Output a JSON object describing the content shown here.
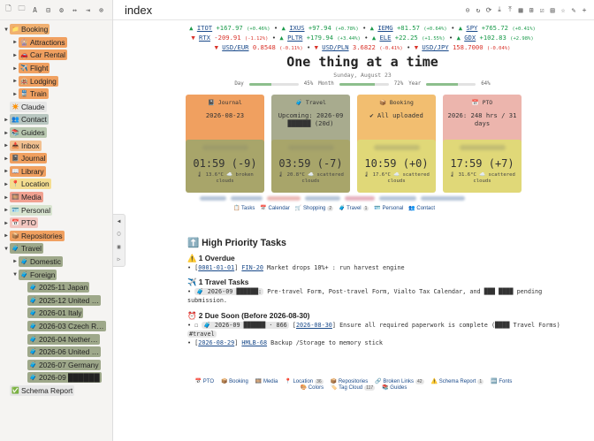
{
  "window": {
    "title": "index"
  },
  "sidebar": {
    "items": [
      {
        "label": "Booking",
        "color": "#f0b070",
        "depth": 0,
        "arrow": "▼",
        "icon": "📁"
      },
      {
        "label": "Attractions",
        "color": "#f0a060",
        "depth": 1,
        "arrow": "▶",
        "icon": "🎡"
      },
      {
        "label": "Car Rental",
        "color": "#f0a060",
        "depth": 1,
        "arrow": "▶",
        "icon": "🚗"
      },
      {
        "label": "Flight",
        "color": "#f0a060",
        "depth": 1,
        "arrow": "▶",
        "icon": "✈️"
      },
      {
        "label": "Lodging",
        "color": "#f0a060",
        "depth": 1,
        "arrow": "▶",
        "icon": "🏨"
      },
      {
        "label": "Train",
        "color": "#f0a060",
        "depth": 1,
        "arrow": "▶",
        "icon": "🚆"
      },
      {
        "label": "Claude",
        "color": "#e6e6e6",
        "depth": 0,
        "arrow": "",
        "icon": "✴️"
      },
      {
        "label": "Contact",
        "color": "#b8c6c0",
        "depth": 0,
        "arrow": "▶",
        "icon": "👥"
      },
      {
        "label": "Guides",
        "color": "#b8c8b0",
        "depth": 0,
        "arrow": "▶",
        "icon": "📚"
      },
      {
        "label": "Inbox",
        "color": "#f2c090",
        "depth": 0,
        "arrow": "▶",
        "icon": "📥"
      },
      {
        "label": "Journal",
        "color": "#f0a060",
        "depth": 0,
        "arrow": "▶",
        "icon": "📓"
      },
      {
        "label": "Library",
        "color": "#f0a060",
        "depth": 0,
        "arrow": "▶",
        "icon": "📖"
      },
      {
        "label": "Location",
        "color": "#f4dd90",
        "depth": 0,
        "arrow": "▶",
        "icon": "📍"
      },
      {
        "label": "Media",
        "color": "#f0a090",
        "depth": 0,
        "arrow": "▶",
        "icon": "🎞️"
      },
      {
        "label": "Personal",
        "color": "#d8e4d0",
        "depth": 0,
        "arrow": "▶",
        "icon": "🪪"
      },
      {
        "label": "PTO",
        "color": "#f2c6c0",
        "depth": 0,
        "arrow": "▶",
        "icon": "📅"
      },
      {
        "label": "Repositories",
        "color": "#f0a060",
        "depth": 0,
        "arrow": "▶",
        "icon": "📦"
      },
      {
        "label": "Travel",
        "color": "#9ea88a",
        "depth": 0,
        "arrow": "▼",
        "icon": "🧳"
      },
      {
        "label": "Domestic",
        "color": "#9ea88a",
        "depth": 1,
        "arrow": "▶",
        "icon": "🧳"
      },
      {
        "label": "Foreign",
        "color": "#9ea88a",
        "depth": 1,
        "arrow": "▼",
        "icon": "🧳"
      },
      {
        "label": "2025-11 Japan",
        "color": "#9ea88a",
        "depth": 2,
        "arrow": "",
        "icon": "🧳"
      },
      {
        "label": "2025-12 United …",
        "color": "#9ea88a",
        "depth": 2,
        "arrow": "",
        "icon": "🧳"
      },
      {
        "label": "2026-01 Italy",
        "color": "#9ea88a",
        "depth": 2,
        "arrow": "",
        "icon": "🧳"
      },
      {
        "label": "2026-03 Czech R…",
        "color": "#9ea88a",
        "depth": 2,
        "arrow": "",
        "icon": "🧳"
      },
      {
        "label": "2026-04 Nether…",
        "color": "#9ea88a",
        "depth": 2,
        "arrow": "",
        "icon": "🧳"
      },
      {
        "label": "2026-06 United …",
        "color": "#9ea88a",
        "depth": 2,
        "arrow": "",
        "icon": "🧳"
      },
      {
        "label": "2026-07 Germany",
        "color": "#9ea88a",
        "depth": 2,
        "arrow": "",
        "icon": "🧳"
      },
      {
        "label": "2026-09 ██████",
        "color": "#9ea88a",
        "depth": 2,
        "arrow": "",
        "icon": "🧳"
      },
      {
        "label": "Schema Report",
        "color": "#e6e6e6",
        "depth": 0,
        "arrow": "",
        "icon": "✅"
      }
    ]
  },
  "tickers": {
    "row1": [
      {
        "dir": "up",
        "sym": "ITOT",
        "val": "+167.97",
        "pct": "(+0.46%)"
      },
      {
        "dir": "up",
        "sym": "IXUS",
        "val": "+97.94",
        "pct": "(+0.78%)"
      },
      {
        "dir": "up",
        "sym": "IEMG",
        "val": "+81.57",
        "pct": "(+0.64%)"
      },
      {
        "dir": "up",
        "sym": "SPY",
        "val": "+765.72",
        "pct": "(+0.41%)"
      }
    ],
    "row2": [
      {
        "dir": "dn",
        "sym": "RTX",
        "val": "-209.91",
        "pct": "(-1.12%)"
      },
      {
        "dir": "up",
        "sym": "PLTR",
        "val": "+179.94",
        "pct": "(+3.44%)"
      },
      {
        "dir": "up",
        "sym": "ELE",
        "val": "+22.25",
        "pct": "(+1.55%)"
      },
      {
        "dir": "up",
        "sym": "GDX",
        "val": "+102.83",
        "pct": "(+2.98%)"
      }
    ],
    "row3": [
      {
        "dir": "dn",
        "sym": "USD/EUR",
        "val": "0.8548",
        "pct": "(-0.11%)"
      },
      {
        "dir": "dn",
        "sym": "USD/PLN",
        "val": "3.6822",
        "pct": "(-0.41%)"
      },
      {
        "dir": "dn",
        "sym": "USD/JPY",
        "val": "158.7000",
        "pct": "(-0.04%)"
      }
    ]
  },
  "heading": "One thing at a time",
  "date": "Sunday, August 23",
  "progress": [
    {
      "label": "Day",
      "value": 0.45,
      "pct": "45%"
    },
    {
      "label": "Month",
      "value": 0.72,
      "pct": "72%"
    },
    {
      "label": "Year",
      "value": 0.64,
      "pct": "64%"
    }
  ],
  "cards": [
    {
      "title": "📓 Journal",
      "body": "2026-08-23",
      "color": "#f0a060"
    },
    {
      "title": "🧳 Travel",
      "body": "Upcoming:  2026-09 ██████ (20d)",
      "color": "#a8ab8e"
    },
    {
      "title": "📦 Booking",
      "body": "✔ All uploaded",
      "color": "#f2be70"
    },
    {
      "title": "📅 PTO",
      "body": "2026: 248 hrs / 31 days",
      "color": "#ecb5ad"
    }
  ],
  "weather": [
    {
      "time": "01:59 (-9)",
      "cond": "🌡 13.6°C  ☁️ broken clouds",
      "color": "#a8a56a"
    },
    {
      "time": "03:59 (-7)",
      "cond": "🌡 20.8°C  ☁️ scattered clouds",
      "color": "#a8a56a"
    },
    {
      "time": "10:59 (+0)",
      "cond": "🌡 17.6°C  ☁️ scattered clouds",
      "color": "#e0d878"
    },
    {
      "time": "17:59 (+7)",
      "cond": "🌡 31.6°C  ☁️ scattered clouds",
      "color": "#e0d878"
    }
  ],
  "nav": [
    {
      "label": "📋 Tasks",
      "badge": ""
    },
    {
      "label": "📅 Calendar",
      "badge": ""
    },
    {
      "label": "🛒 Shopping",
      "badge": "2"
    },
    {
      "label": "🧳 Travel",
      "badge": "1"
    },
    {
      "label": "🪪 Personal",
      "badge": ""
    },
    {
      "label": "👥 Contact",
      "badge": ""
    }
  ],
  "tasks": {
    "title": "⬆️ High Priority Tasks",
    "overdue_title": "⚠️ 1 Overdue",
    "overdue": {
      "date": "0001-01-01",
      "link": "FIN-20",
      "text": "Market drops 10%+ : run harvest engine"
    },
    "travel_title": "✈️  1 Travel Tasks",
    "travel": {
      "prefix": "🧳 2026-09 ██████:",
      "text": "Pre-travel Form, Post-travel Form, Vialto Tax Calendar, and ███ ████ pending submission."
    },
    "due_title": "⏰  2 Due Soon (Before 2026-08-30)",
    "due1": {
      "prefix": "🧳 2026-09 ██████ · 866",
      "date": "2026-08-30",
      "text": "Ensure all required paperwork is complete (████ Travel Forms)",
      "tag": "#travel"
    },
    "due2": {
      "date": "2026-08-29",
      "link": "HMLB-68",
      "text": "Backup /Storage to memory stick"
    }
  },
  "footer": [
    {
      "label": "📅 PTO",
      "badge": ""
    },
    {
      "label": "📦 Booking",
      "badge": ""
    },
    {
      "label": "🎞️ Media",
      "badge": ""
    },
    {
      "label": "📍 Location",
      "badge": "36"
    },
    {
      "label": "📦 Repositories",
      "badge": ""
    },
    {
      "label": "🔗 Broken Links",
      "badge": "42"
    },
    {
      "label": "⚠️ Schema Report",
      "badge": "1"
    },
    {
      "label": "🔤 Fonts",
      "badge": ""
    },
    {
      "label": "🎨 Colors",
      "badge": ""
    },
    {
      "label": "🏷️ Tag Cloud",
      "badge": "117"
    },
    {
      "label": "📚 Guides",
      "badge": ""
    }
  ]
}
